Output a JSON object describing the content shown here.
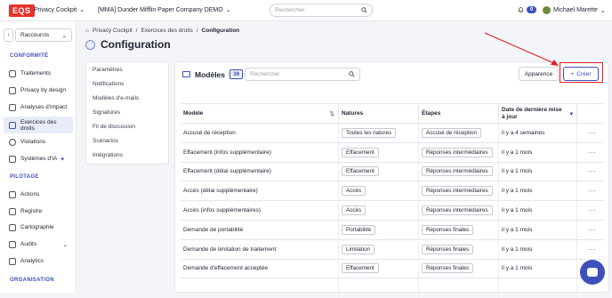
{
  "topbar": {
    "logo": "EQS",
    "product": "Privacy Cockpit",
    "company": "[MMA] Dunder Mifflin Paper Company DEMO",
    "search_placeholder": "Rechercher",
    "notifications_count": "0",
    "user_name": "Michael Marette"
  },
  "sidebar": {
    "shortcuts_label": "Raccourcis",
    "sections": {
      "conformite": "CONFORMITÉ",
      "pilotage": "PILOTAGE",
      "organisation": "ORGANISATION"
    },
    "items": [
      {
        "label": "Traitements"
      },
      {
        "label": "Privacy by design"
      },
      {
        "label": "Analyses d'impact"
      },
      {
        "label": "Exercices des droits"
      },
      {
        "label": "Violations"
      },
      {
        "label": "Systèmes d'IA"
      },
      {
        "label": "Actions"
      },
      {
        "label": "Registre"
      },
      {
        "label": "Cartographie"
      },
      {
        "label": "Audits"
      },
      {
        "label": "Analytics"
      }
    ]
  },
  "breadcrumb": {
    "root": "Privacy Cockpit",
    "parent": "Exercices des droits",
    "current": "Configuration"
  },
  "page": {
    "title": "Configuration"
  },
  "left_menu": [
    "Paramètres",
    "Notifications",
    "Modèles d'e-mails",
    "Signatures",
    "Fil de discussion",
    "Scénarios",
    "Intégrations"
  ],
  "panel": {
    "title": "Modèles",
    "count": "36",
    "search_placeholder": "Rechercher",
    "appearance_label": "Apparence",
    "create_label": "Créer"
  },
  "table": {
    "headers": [
      "Modèle",
      "Natures",
      "Étapes",
      "Date de dernière mise à jour"
    ],
    "rows": [
      {
        "model": "Accusé de réception",
        "nature": "Toutes les natures",
        "step": "Accusé de réception",
        "date": "il y a 4 semaines"
      },
      {
        "model": "Effacement (infos supplémentaire)",
        "nature": "Effacement",
        "step": "Réponses intermédiaires",
        "date": "il y a 1 mois"
      },
      {
        "model": "Effacement (délai supplémentaire)",
        "nature": "Effacement",
        "step": "Réponses intermédiaires",
        "date": "il y a 1 mois"
      },
      {
        "model": "Accès (délai supplémentaire)",
        "nature": "Accès",
        "step": "Réponses intermédiaires",
        "date": "il y a 1 mois"
      },
      {
        "model": "Accès (infos supplémentaires)",
        "nature": "Accès",
        "step": "Réponses intermédiaires",
        "date": "il y a 1 mois"
      },
      {
        "model": "Demande de portabilité",
        "nature": "Portabilité",
        "step": "Réponses finales",
        "date": "il y a 1 mois"
      },
      {
        "model": "Demande de limitation de traitement",
        "nature": "Limitation",
        "step": "Réponses finales",
        "date": "il y a 1 mois"
      },
      {
        "model": "Demande d'effacement acceptée",
        "nature": "Effacement",
        "step": "Réponses finales",
        "date": "il y a 1 mois"
      },
      {
        "model": "",
        "nature": "",
        "step": "",
        "date": ""
      }
    ]
  },
  "colors": {
    "accent": "#3d4fb8",
    "logo_red": "#e6332a",
    "highlight_red": "#e0202a"
  }
}
